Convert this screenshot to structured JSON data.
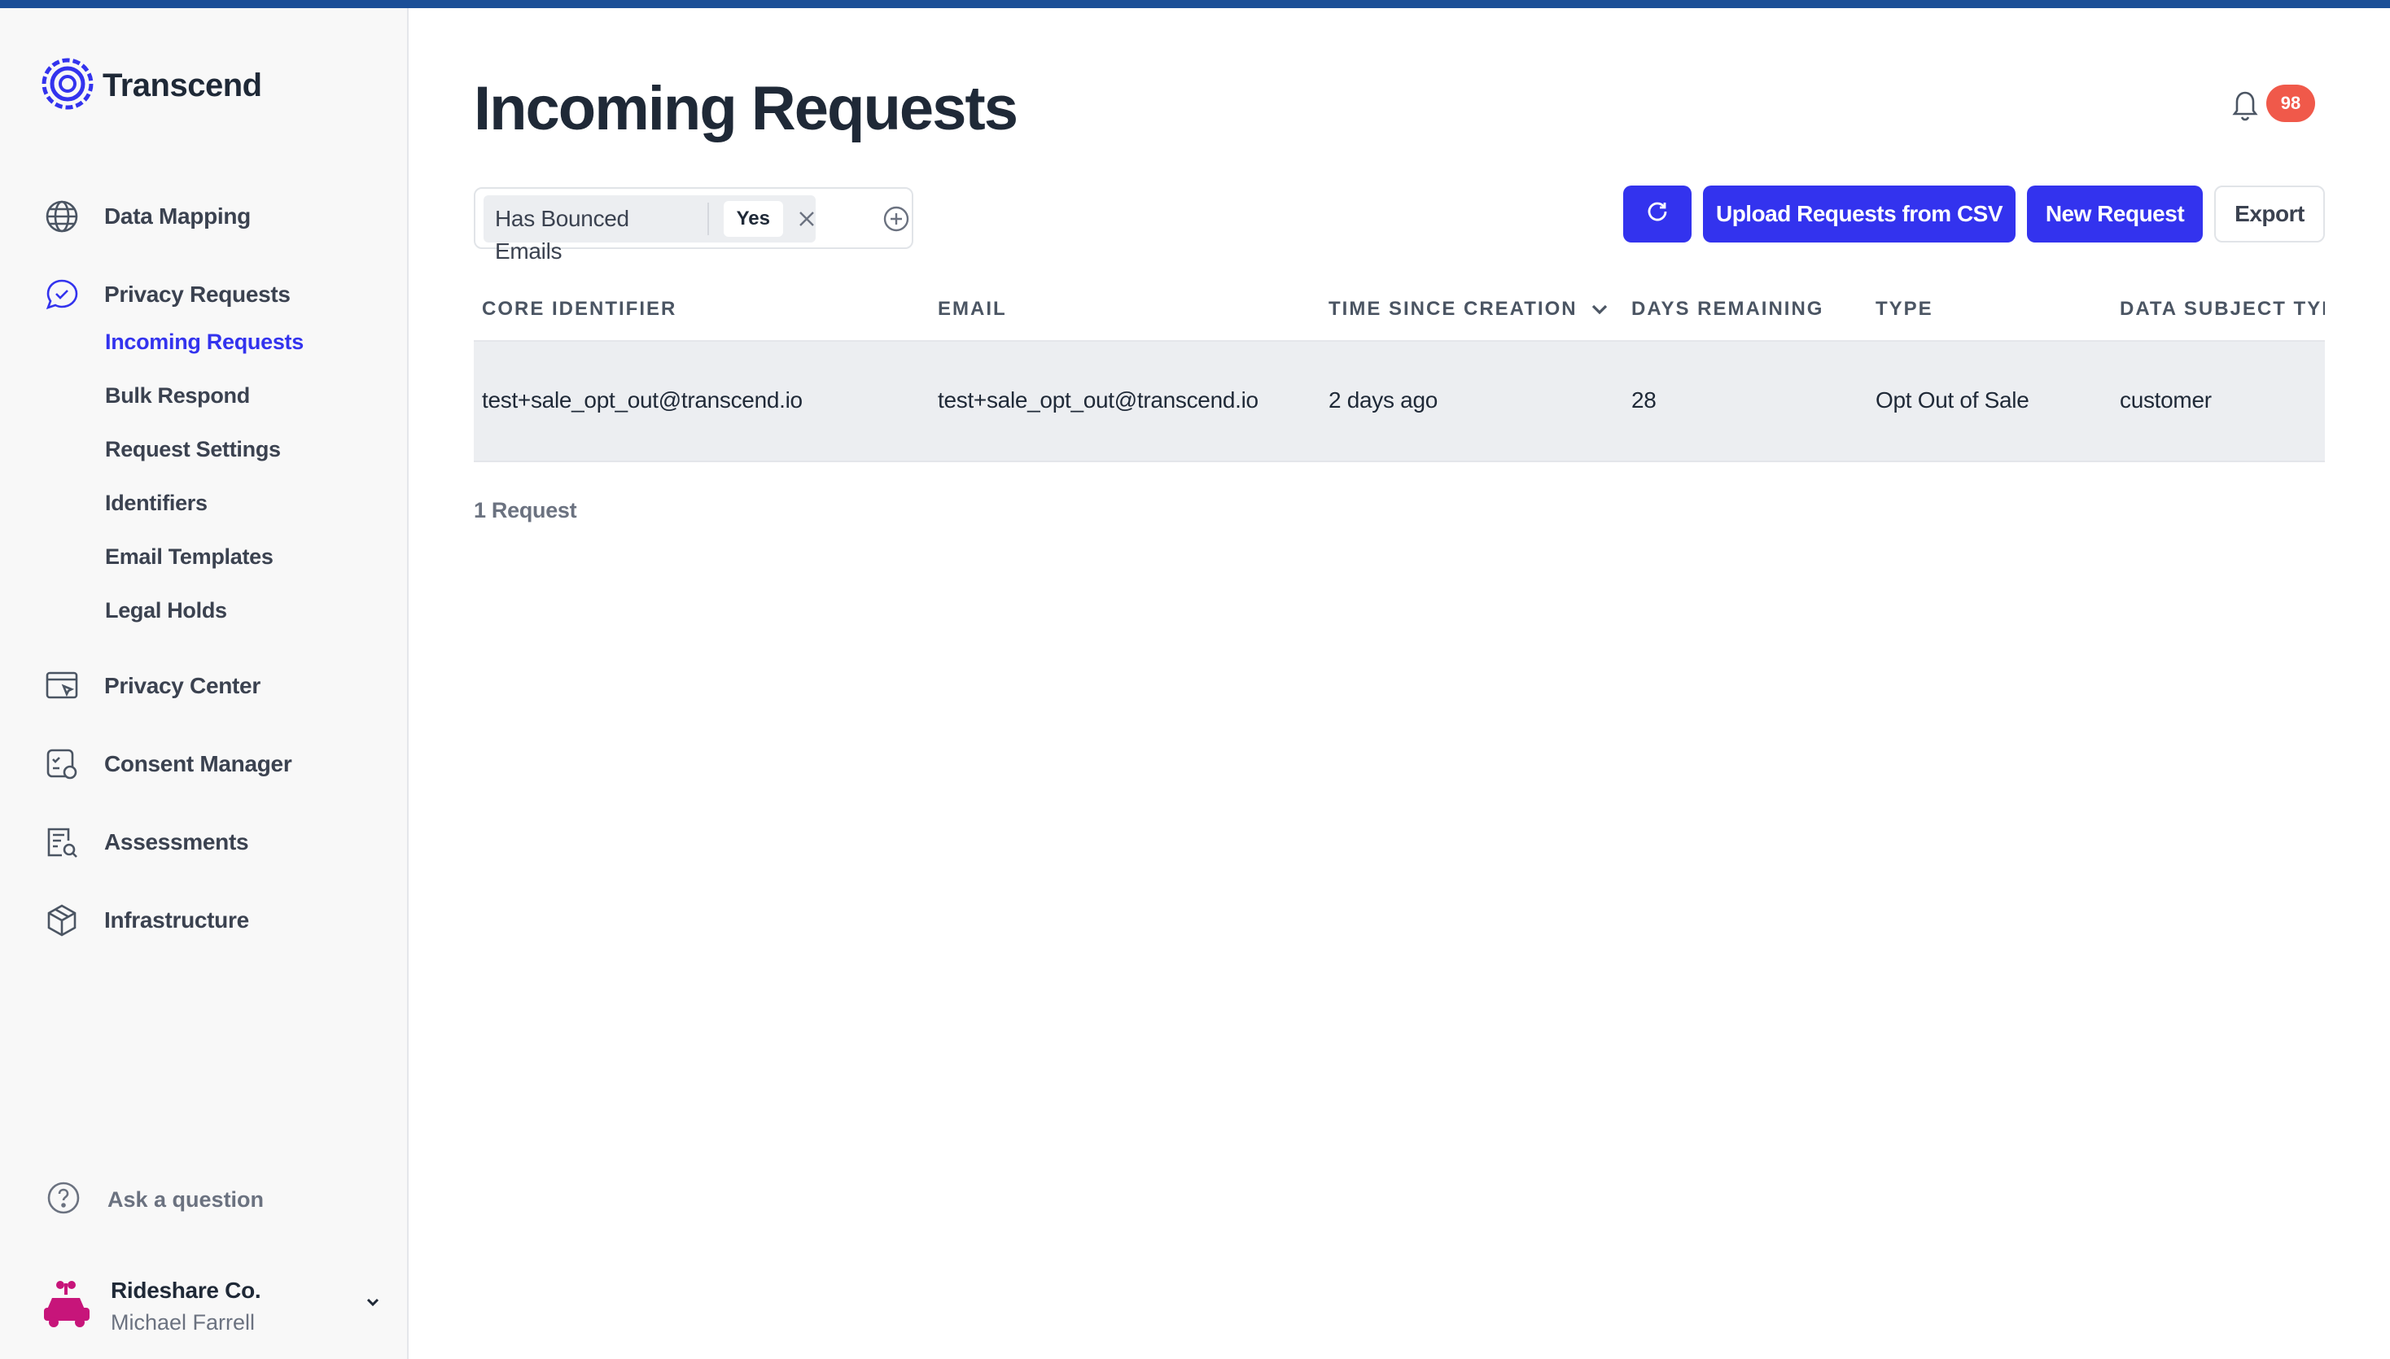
{
  "brand": {
    "name": "Transcend",
    "accent": "#3333ee",
    "topbar": "#1c4f97"
  },
  "sidebar": {
    "items": [
      {
        "label": "Data Mapping",
        "icon": "globe-icon"
      },
      {
        "label": "Privacy Requests",
        "icon": "chat-check-icon"
      },
      {
        "label": "Privacy Center",
        "icon": "browser-cursor-icon"
      },
      {
        "label": "Consent Manager",
        "icon": "consent-icon"
      },
      {
        "label": "Assessments",
        "icon": "document-search-icon"
      },
      {
        "label": "Infrastructure",
        "icon": "cube-icon"
      }
    ],
    "subitems": [
      {
        "label": "Incoming Requests",
        "active": true
      },
      {
        "label": "Bulk Respond"
      },
      {
        "label": "Request Settings"
      },
      {
        "label": "Identifiers"
      },
      {
        "label": "Email Templates"
      },
      {
        "label": "Legal Holds"
      }
    ],
    "help": {
      "label": "Ask a question",
      "icon": "question-circle-icon"
    },
    "account": {
      "org": "Rideshare Co.",
      "user": "Michael Farrell",
      "icon": "car-gift-icon"
    }
  },
  "header": {
    "title": "Incoming Requests",
    "notifications": {
      "count": "98",
      "icon": "bell-icon"
    }
  },
  "filter": {
    "field": "Has Bounced Emails",
    "value": "Yes",
    "remove_icon": "close-icon",
    "add_icon": "plus-circle-icon"
  },
  "toolbar": {
    "refresh_icon": "refresh-icon",
    "upload_label": "Upload Requests from CSV",
    "new_label": "New Request",
    "export_label": "Export"
  },
  "table": {
    "columns": [
      "CORE IDENTIFIER",
      "EMAIL",
      "TIME SINCE CREATION",
      "DAYS REMAINING",
      "TYPE",
      "DATA SUBJECT TYPE"
    ],
    "sorted_column_icon": "chevron-down-icon",
    "rows": [
      [
        "test+sale_opt_out@transcend.io",
        "test+sale_opt_out@transcend.io",
        "2 days ago",
        "28",
        "Opt Out of Sale",
        "customer"
      ]
    ]
  },
  "footer": {
    "count_label": "1 Request"
  }
}
